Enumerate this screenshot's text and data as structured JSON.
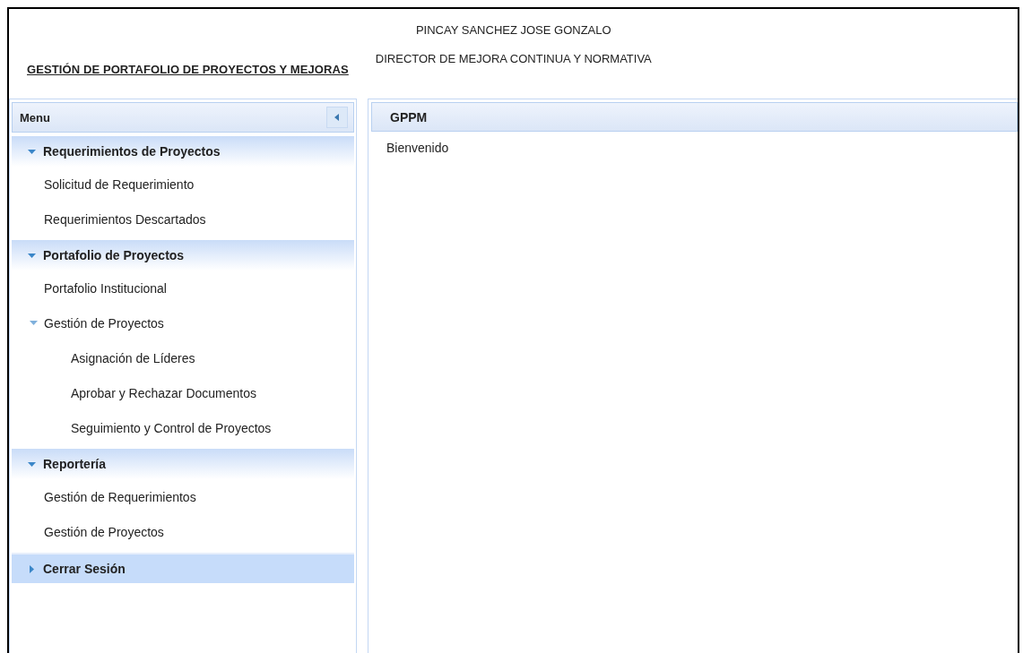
{
  "header": {
    "title": "GESTIÓN DE PORTAFOLIO DE PROYECTOS Y MEJORAS",
    "user": "PINCAY SANCHEZ JOSE GONZALO",
    "role": "DIRECTOR DE MEJORA CONTINUA Y NORMATIVA"
  },
  "menu": {
    "title": "Menu",
    "sections": [
      {
        "label": "Requerimientos de Proyectos",
        "expanded": true,
        "items": [
          {
            "label": "Solicitud de Requerimiento"
          },
          {
            "label": "Requerimientos Descartados"
          }
        ]
      },
      {
        "label": "Portafolio de Proyectos",
        "expanded": true,
        "items": [
          {
            "label": "Portafolio Institucional"
          },
          {
            "label": "Gestión de Proyectos",
            "expanded": true,
            "children": [
              {
                "label": "Asignación de Líderes"
              },
              {
                "label": "Aprobar y Rechazar Documentos"
              },
              {
                "label": "Seguimiento y Control de Proyectos"
              }
            ]
          }
        ]
      },
      {
        "label": "Reportería",
        "expanded": true,
        "items": [
          {
            "label": "Gestión de Requerimientos"
          },
          {
            "label": "Gestión de Proyectos"
          }
        ]
      },
      {
        "label": "Cerrar Sesión",
        "expanded": false
      }
    ]
  },
  "content": {
    "title": "GPPM",
    "body": "Bienvenido"
  }
}
